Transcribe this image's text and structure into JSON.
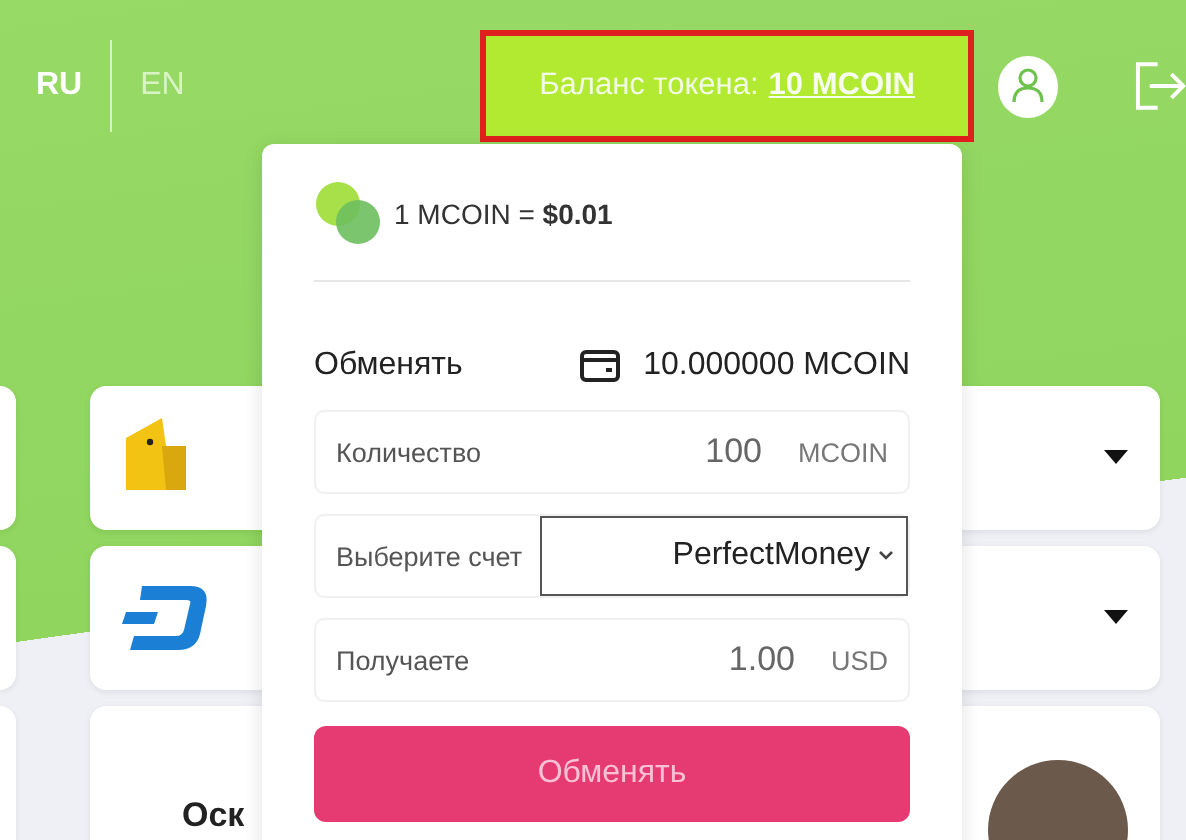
{
  "language_switch": [
    {
      "label": "RU",
      "selected": true
    },
    {
      "label": "EN",
      "selected": false
    }
  ],
  "token_balance": {
    "label": "Баланс токена:",
    "value": "10 MCOIN"
  },
  "cards": [
    {
      "kind": "wallet"
    },
    {
      "kind": "dash"
    },
    {
      "kind": "person",
      "name": "Оск"
    }
  ],
  "exchange_popup": {
    "rate": "1 MCOIN = **$0.01**",
    "title": "Обменять",
    "balance": "10.000000 MCOIN",
    "fields": [
      {
        "kind": "input",
        "label": "Количество",
        "value": "100",
        "unit": "MCOIN"
      },
      {
        "kind": "select",
        "label": "Выберите счет",
        "value": "PerfectMoney"
      },
      {
        "kind": "input",
        "label": "Получаете",
        "value": "1.00",
        "unit": "USD"
      }
    ],
    "button": "Обменять"
  }
}
